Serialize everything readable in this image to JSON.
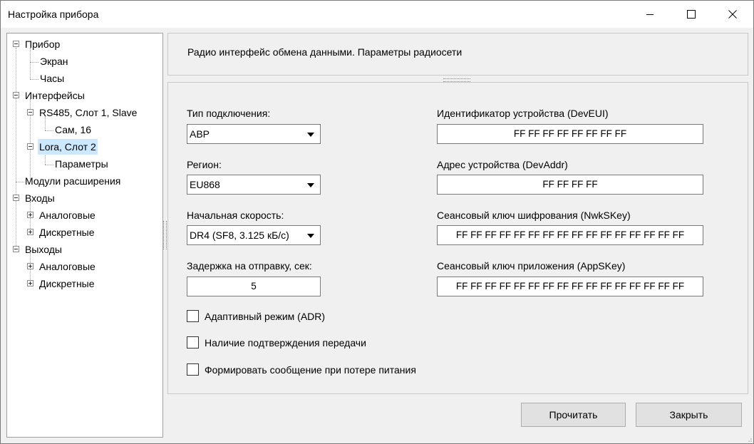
{
  "window": {
    "title": "Настройка прибора",
    "min_icon": "minimize-icon",
    "max_icon": "maximize-icon",
    "close_icon": "close-icon"
  },
  "tree": {
    "items": [
      {
        "label": "Прибор",
        "expanded": true
      },
      {
        "label": "Экран"
      },
      {
        "label": "Часы"
      },
      {
        "label": "Интерфейсы",
        "expanded": true
      },
      {
        "label": "RS485, Слот 1, Slave",
        "expanded": true
      },
      {
        "label": "Сам, 16"
      },
      {
        "label": "Lora, Слот 2",
        "expanded": true,
        "selected": true
      },
      {
        "label": "Параметры"
      },
      {
        "label": "Модули расширения"
      },
      {
        "label": "Входы",
        "expanded": true
      },
      {
        "label": "Аналоговые",
        "expanded": false
      },
      {
        "label": "Дискретные",
        "expanded": false
      },
      {
        "label": "Выходы",
        "expanded": true
      },
      {
        "label": "Аналоговые",
        "expanded": false
      },
      {
        "label": "Дискретные",
        "expanded": false
      }
    ],
    "selected_color": "#cce8ff"
  },
  "header": {
    "text": "Радио интерфейс обмена данными. Параметры радиосети"
  },
  "form": {
    "connection_type": {
      "label": "Тип подключения:",
      "value": "ABP"
    },
    "region": {
      "label": "Регион:",
      "value": "EU868"
    },
    "initial_speed": {
      "label": "Начальная скорость:",
      "value": "DR4 (SF8, 3.125 кБ/с)"
    },
    "send_delay": {
      "label": "Задержка на отправку, сек:",
      "value": "5"
    },
    "dev_eui": {
      "label": "Идентификатор устройства (DevEUI)",
      "value": "FF FF FF FF FF FF FF FF"
    },
    "dev_addr": {
      "label": "Адрес устройства (DevAddr)",
      "value": "FF FF FF FF"
    },
    "nwk_skey": {
      "label": "Сеансовый ключ шифрования (NwkSKey)",
      "value": "FF FF FF FF FF FF FF FF FF FF FF FF FF FF FF FF"
    },
    "app_skey": {
      "label": "Сеансовый ключ приложения (AppSKey)",
      "value": "FF FF FF FF FF FF FF FF FF FF FF FF FF FF FF FF"
    },
    "checkboxes": [
      {
        "label": "Адаптивный режим (ADR)",
        "checked": false
      },
      {
        "label": "Наличие подтверждения передачи",
        "checked": false
      },
      {
        "label": "Формировать сообщение при потере питания",
        "checked": false
      }
    ]
  },
  "buttons": {
    "read": "Прочитать",
    "close": "Закрыть"
  }
}
